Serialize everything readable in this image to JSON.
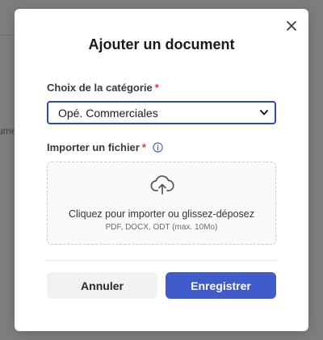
{
  "background": {
    "partial_text": "ume"
  },
  "modal": {
    "title": "Ajouter un document",
    "close_icon": "close-icon",
    "category": {
      "label": "Choix de la catégorie",
      "required_mark": "*",
      "selected_value": "Opé. Commerciales"
    },
    "file": {
      "label": "Importer un fichier",
      "required_mark": "*",
      "info_icon": "info-icon",
      "upload_icon": "cloud-upload-icon",
      "drop_text": "Cliquez pour importer ou glissez-déposez",
      "formats_text": "PDF, DOCX, ODT (max. 10Mo)"
    },
    "buttons": {
      "cancel_label": "Annuler",
      "save_label": "Enregistrer"
    },
    "colors": {
      "accent": "#3f5bcc",
      "focus_border": "#2d4bb3",
      "required": "#e0364a"
    }
  }
}
